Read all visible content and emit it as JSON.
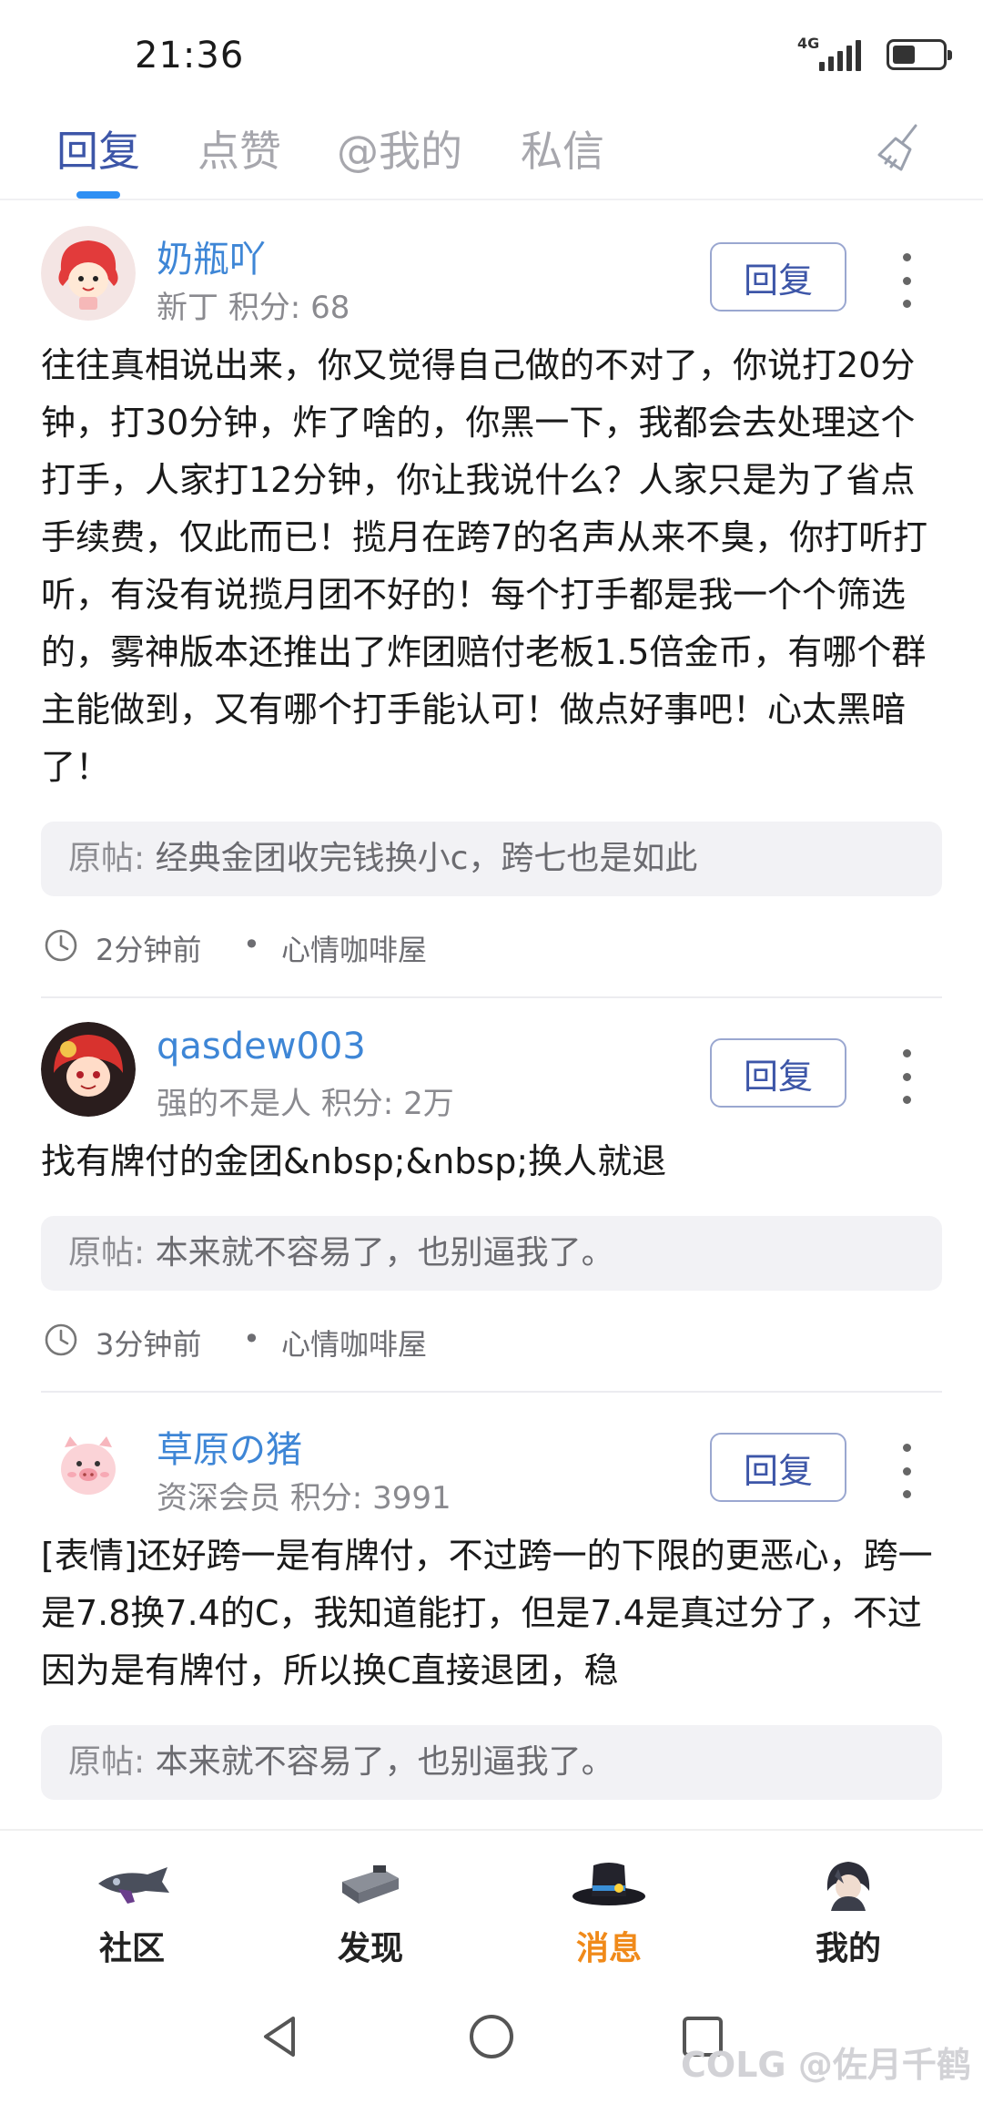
{
  "status": {
    "time": "21:36",
    "network": "4G",
    "battery_level": 0.45
  },
  "tabs": [
    {
      "label": "回复",
      "active": true
    },
    {
      "label": "点赞",
      "active": false
    },
    {
      "label": "@我的",
      "active": false
    },
    {
      "label": "私信",
      "active": false
    }
  ],
  "accent_color": "#3d56a8",
  "posts": [
    {
      "user": "奶瓶吖",
      "rank": "新丁",
      "points_label": "积分: 68",
      "reply_label": "回复",
      "body": "往往真相说出来，你又觉得自己做的不对了，你说打20分钟，打30分钟，炸了啥的，你黑一下，我都会去处理这个打手，人家打12分钟，你让我说什么？人家只是为了省点手续费，仅此而已！揽月在跨7的名声从来不臭，你打听打听，有没有说揽月团不好的！每个打手都是我一个个筛选的，雾神版本还推出了炸团赔付老板1.5倍金币，有哪个群主能做到，又有哪个打手能认可！做点好事吧！心太黑暗了！",
      "quote_label": "原帖:",
      "quote": "经典金团收完钱换小c，跨七也是如此",
      "time": "2分钟前",
      "dot": "•",
      "place": "心情咖啡屋"
    },
    {
      "user": "qasdew003",
      "rank": "强的不是人",
      "points_label": "积分: 2万",
      "reply_label": "回复",
      "body": "找有牌付的金团&nbsp;&nbsp;换人就退",
      "quote_label": "原帖:",
      "quote": "本来就不容易了，也别逼我了。",
      "time": "3分钟前",
      "dot": "•",
      "place": "心情咖啡屋"
    },
    {
      "user": "草原の猪",
      "rank": "资深会员",
      "points_label": "积分: 3991",
      "reply_label": "回复",
      "body": "[表情]还好跨一是有牌付，不过跨一的下限的更恶心，跨一是7.8换7.4的C，我知道能打，但是7.4是真过分了，不过因为是有牌付，所以换C直接退团，稳",
      "quote_label": "原帖:",
      "quote": "本来就不容易了，也别逼我了。"
    }
  ],
  "bottom_nav": [
    {
      "label": "社区",
      "icon": "airship-icon",
      "active": false
    },
    {
      "label": "发现",
      "icon": "machine-icon",
      "active": false
    },
    {
      "label": "消息",
      "icon": "top-hat-icon",
      "active": true
    },
    {
      "label": "我的",
      "icon": "character-avatar-icon",
      "active": false
    }
  ],
  "active_nav_color": "#f08a1a",
  "watermark": "COLG @佐月千鹤"
}
